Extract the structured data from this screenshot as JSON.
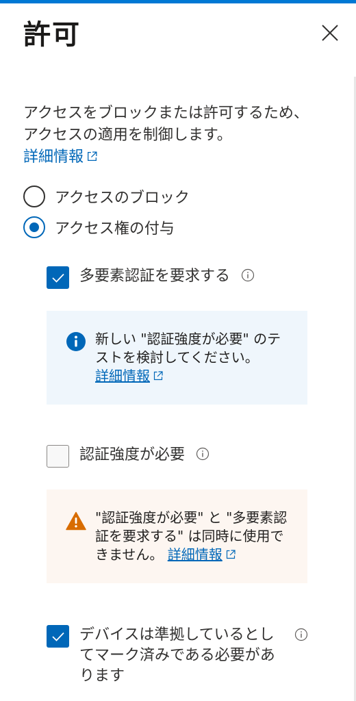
{
  "header": {
    "title": "許可",
    "close_label": "×"
  },
  "description": {
    "text": "アクセスをブロックまたは許可するため、アクセスの適用を制御します。",
    "learn_more": "詳細情報"
  },
  "access": {
    "block_label": "アクセスのブロック",
    "grant_label": "アクセス権の付与",
    "selected": "grant"
  },
  "controls": {
    "mfa": {
      "label": "多要素認証を要求する",
      "checked": true
    },
    "auth_strength": {
      "label": "認証強度が必要",
      "checked": false
    },
    "compliant_device": {
      "label": "デバイスは準拠しているとしてマーク済みである必要があります",
      "checked": true
    }
  },
  "info_banner": {
    "text": "新しい \"認証強度が必要\" のテストを検討してください。",
    "link": "詳細情報"
  },
  "warning_banner": {
    "text": "\"認証強度が必要\" と \"多要素認証を要求する\" は同時に使用できません。",
    "link": "詳細情報"
  },
  "colors": {
    "accent": "#0078d4",
    "link": "#0067b8",
    "info_bg": "#eff6fc",
    "warning_bg": "#fdf6f1",
    "warning_icon": "#d86c00"
  },
  "icons": [
    "close-icon",
    "external-link-icon",
    "info-icon",
    "info-filled-icon",
    "warning-icon",
    "checkmark-icon"
  ]
}
